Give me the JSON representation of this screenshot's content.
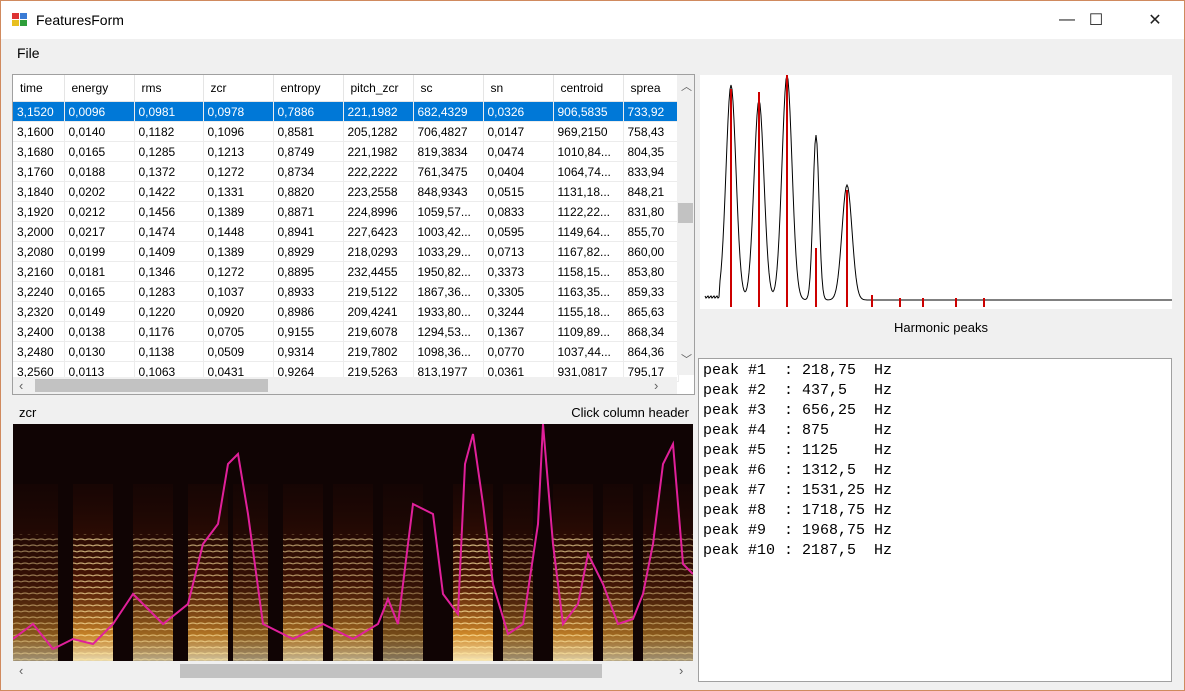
{
  "window": {
    "title": "FeaturesForm",
    "minimize": "—",
    "maximize": "☐",
    "close": "✕"
  },
  "menu": {
    "file": "File"
  },
  "grid": {
    "columns": [
      "time",
      "energy",
      "rms",
      "zcr",
      "entropy",
      "pitch_zcr",
      "sc",
      "sn",
      "centroid",
      "sprea"
    ],
    "selected_row": 0,
    "rows": [
      [
        "3,1520",
        "0,0096",
        "0,0981",
        "0,0978",
        "0,7886",
        "221,1982",
        "682,4329",
        "0,0326",
        "906,5835",
        "733,92"
      ],
      [
        "3,1600",
        "0,0140",
        "0,1182",
        "0,1096",
        "0,8581",
        "205,1282",
        "706,4827",
        "0,0147",
        "969,2150",
        "758,43"
      ],
      [
        "3,1680",
        "0,0165",
        "0,1285",
        "0,1213",
        "0,8749",
        "221,1982",
        "819,3834",
        "0,0474",
        "1010,84...",
        "804,35"
      ],
      [
        "3,1760",
        "0,0188",
        "0,1372",
        "0,1272",
        "0,8734",
        "222,2222",
        "761,3475",
        "0,0404",
        "1064,74...",
        "833,94"
      ],
      [
        "3,1840",
        "0,0202",
        "0,1422",
        "0,1331",
        "0,8820",
        "223,2558",
        "848,9343",
        "0,0515",
        "1131,18...",
        "848,21"
      ],
      [
        "3,1920",
        "0,0212",
        "0,1456",
        "0,1389",
        "0,8871",
        "224,8996",
        "1059,57...",
        "0,0833",
        "1122,22...",
        "831,80"
      ],
      [
        "3,2000",
        "0,0217",
        "0,1474",
        "0,1448",
        "0,8941",
        "227,6423",
        "1003,42...",
        "0,0595",
        "1149,64...",
        "855,70"
      ],
      [
        "3,2080",
        "0,0199",
        "0,1409",
        "0,1389",
        "0,8929",
        "218,0293",
        "1033,29...",
        "0,0713",
        "1167,82...",
        "860,00"
      ],
      [
        "3,2160",
        "0,0181",
        "0,1346",
        "0,1272",
        "0,8895",
        "232,4455",
        "1950,82...",
        "0,3373",
        "1158,15...",
        "853,80"
      ],
      [
        "3,2240",
        "0,0165",
        "0,1283",
        "0,1037",
        "0,8933",
        "219,5122",
        "1867,36...",
        "0,3305",
        "1163,35...",
        "859,33"
      ],
      [
        "3,2320",
        "0,0149",
        "0,1220",
        "0,0920",
        "0,8986",
        "209,4241",
        "1933,80...",
        "0,3244",
        "1155,18...",
        "865,63"
      ],
      [
        "3,2400",
        "0,0138",
        "0,1176",
        "0,0705",
        "0,9155",
        "219,6078",
        "1294,53...",
        "0,1367",
        "1109,89...",
        "868,34"
      ],
      [
        "3,2480",
        "0,0130",
        "0,1138",
        "0,0509",
        "0,9314",
        "219,7802",
        "1098,36...",
        "0,0770",
        "1037,44...",
        "864,36"
      ],
      [
        "3,2560",
        "0,0113",
        "0,1063",
        "0,0431",
        "0,9264",
        "219,5263",
        "813,1977",
        "0,0361",
        "931,0817",
        "795,17"
      ]
    ]
  },
  "labels": {
    "feature": "zcr",
    "hint": "Click column header",
    "harmonic": "Harmonic peaks"
  },
  "peaks": [
    "peak #1  : 218,75  Hz",
    "peak #2  : 437,5   Hz",
    "peak #3  : 656,25  Hz",
    "peak #4  : 875     Hz",
    "peak #5  : 1125    Hz",
    "peak #6  : 1312,5  Hz",
    "peak #7  : 1531,25 Hz",
    "peak #8  : 1718,75 Hz",
    "peak #9  : 1968,75 Hz",
    "peak #10 : 2187,5  Hz"
  ],
  "colors": {
    "selection": "#0078d7",
    "peak_marker": "#cc0000",
    "zcr_curve": "#e0209a"
  }
}
